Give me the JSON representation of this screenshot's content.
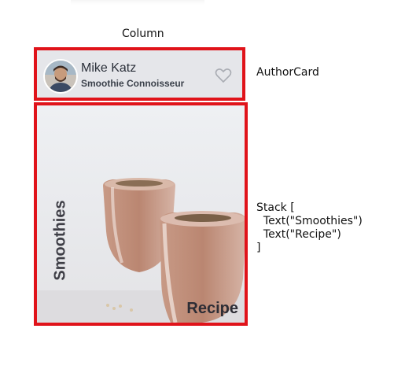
{
  "labels": {
    "column": "Column",
    "author_card": "AuthorCard",
    "stack": "Stack [\n  Text(\"Smoothies\")\n  Text(\"Recipe\")\n]"
  },
  "author_card": {
    "name": "Mike Katz",
    "title": "Smoothie Connoisseur",
    "avatar_icon": "person-photo",
    "favorite_icon": "heart-outline-icon"
  },
  "stack": {
    "vertical_text": "Smoothies",
    "corner_text": "Recipe",
    "image": "smoothie-glasses-photo"
  },
  "colors": {
    "highlight_border": "#e0131a",
    "card_background": "#e5e6ea"
  }
}
